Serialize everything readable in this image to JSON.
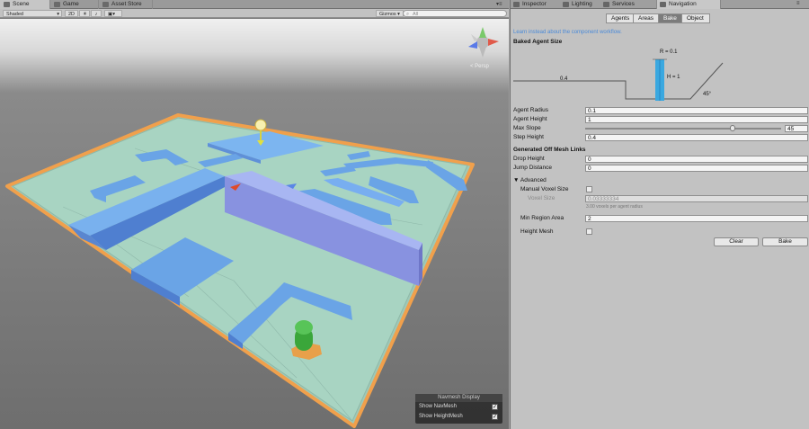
{
  "scene_tabs": [
    {
      "label": "Scene",
      "icon": "scene-icon"
    },
    {
      "label": "Game",
      "icon": "game-icon"
    },
    {
      "label": "Asset Store",
      "icon": "store-icon"
    }
  ],
  "scene_toolbar": {
    "shading": "Shaded",
    "mode_2d": "2D",
    "lighting_icon": "sun-icon",
    "audio_icon": "speaker-icon",
    "effects_icon": "image-icon",
    "gizmos": "Gizmos",
    "search_placeholder": "All"
  },
  "scene_view": {
    "persp_label": "< Persp",
    "colors": {
      "ground": "#9ec9b8",
      "navmesh": "#6aa4e6",
      "outline": "#f0a04c",
      "agent": "#39a83a",
      "sky": "#7a7a7a"
    }
  },
  "navmesh_display": {
    "title": "Navmesh Display",
    "show_navmesh": {
      "label": "Show NavMesh",
      "checked": true
    },
    "show_heightmesh": {
      "label": "Show HeightMesh",
      "checked": true
    }
  },
  "inspector_tabs": [
    {
      "label": "Inspector",
      "icon": "inspector-icon"
    },
    {
      "label": "Lighting",
      "icon": "lighting-icon"
    },
    {
      "label": "Services",
      "icon": "cloud-icon"
    },
    {
      "label": "Navigation",
      "icon": "navigation-icon"
    }
  ],
  "nav_sections": [
    "Agents",
    "Areas",
    "Bake",
    "Object"
  ],
  "active_section": "Bake",
  "workflow_link": "Learn instead about the component workflow.",
  "baked_agent_size": {
    "heading": "Baked Agent Size",
    "r_label": "R = 0.1",
    "h_label": "H = 1",
    "step_label": "0.4",
    "slope_label": "45°"
  },
  "fields": {
    "agent_radius": {
      "label": "Agent Radius",
      "value": "0.1"
    },
    "agent_height": {
      "label": "Agent Height",
      "value": "1"
    },
    "max_slope": {
      "label": "Max Slope",
      "value": "45",
      "fraction": 0.75
    },
    "step_height": {
      "label": "Step Height",
      "value": "0.4"
    }
  },
  "offmesh": {
    "heading": "Generated Off Mesh Links",
    "drop_height": {
      "label": "Drop Height",
      "value": "0"
    },
    "jump_distance": {
      "label": "Jump Distance",
      "value": "0"
    }
  },
  "advanced": {
    "heading": "Advanced",
    "manual_voxel": {
      "label": "Manual Voxel Size",
      "checked": false
    },
    "voxel_size": {
      "label": "Voxel Size",
      "value": "0.03333334"
    },
    "voxel_hint": "3.00 voxels per agent radius",
    "min_region": {
      "label": "Min Region Area",
      "value": "2"
    },
    "height_mesh": {
      "label": "Height Mesh",
      "checked": false
    }
  },
  "buttons": {
    "clear": "Clear",
    "bake": "Bake"
  }
}
